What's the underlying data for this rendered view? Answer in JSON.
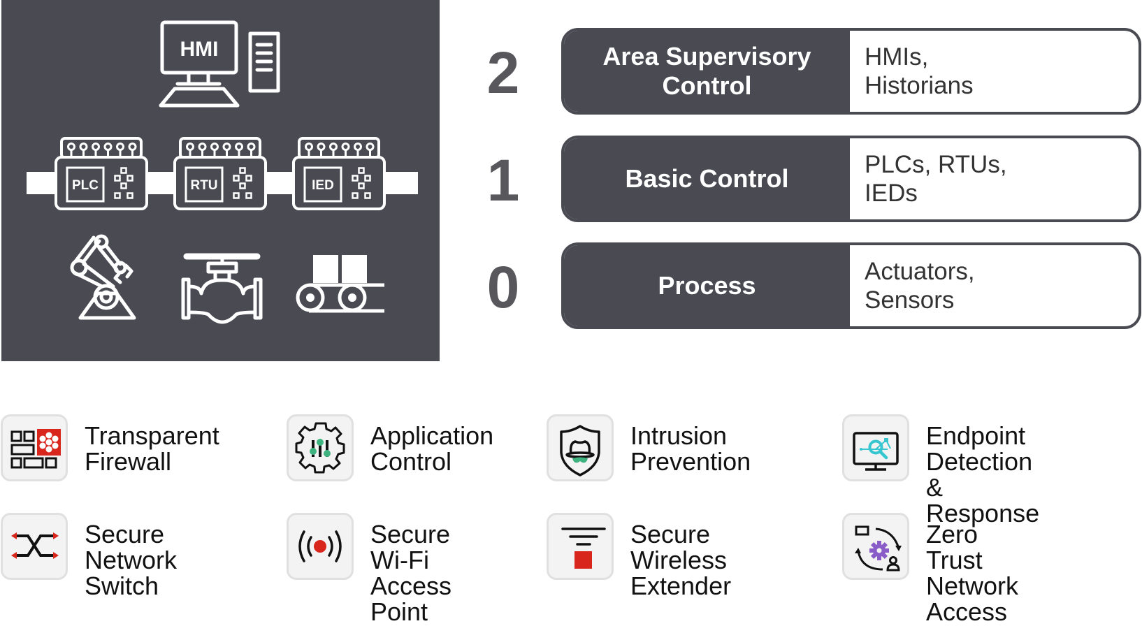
{
  "diagram": {
    "panel": {
      "hmi_label": "HMI",
      "controllers": [
        "PLC",
        "RTU",
        "IED"
      ],
      "field_devices": [
        "robotic-arm",
        "valve",
        "conveyor"
      ]
    },
    "levels": [
      {
        "number": "2",
        "name": "Area Supervisory Control",
        "devices": "HMIs,\nHistorians"
      },
      {
        "number": "1",
        "name": "Basic Control",
        "devices": "PLCs, RTUs,\nIEDs"
      },
      {
        "number": "0",
        "name": "Process",
        "devices": "Actuators,\nSensors"
      }
    ],
    "features": [
      {
        "label": "Transparent\nFirewall",
        "icon": "firewall-icon"
      },
      {
        "label": "Application\nControl",
        "icon": "application-control-icon"
      },
      {
        "label": "Intrusion\nPrevention",
        "icon": "intrusion-prevention-icon"
      },
      {
        "label": "Endpoint Detection\n& Response",
        "icon": "endpoint-detection-icon"
      },
      {
        "label": "Secure\nNetwork Switch",
        "icon": "network-switch-icon"
      },
      {
        "label": "Secure Wi-Fi\nAccess Point",
        "icon": "wifi-access-point-icon"
      },
      {
        "label": "Secure Wireless\nExtender",
        "icon": "wireless-extender-icon"
      },
      {
        "label": "Zero Trust\nNetwork Access",
        "icon": "zero-trust-icon"
      }
    ],
    "colors": {
      "panel": "#4a4a53",
      "level_number": "#57575c",
      "accent_red": "#d9261c",
      "accent_green": "#3fb37f",
      "accent_teal": "#35c6cf",
      "accent_purple": "#8a5cc7",
      "icon_bg": "#f3f3f3",
      "icon_border": "#e0e0e0"
    }
  }
}
